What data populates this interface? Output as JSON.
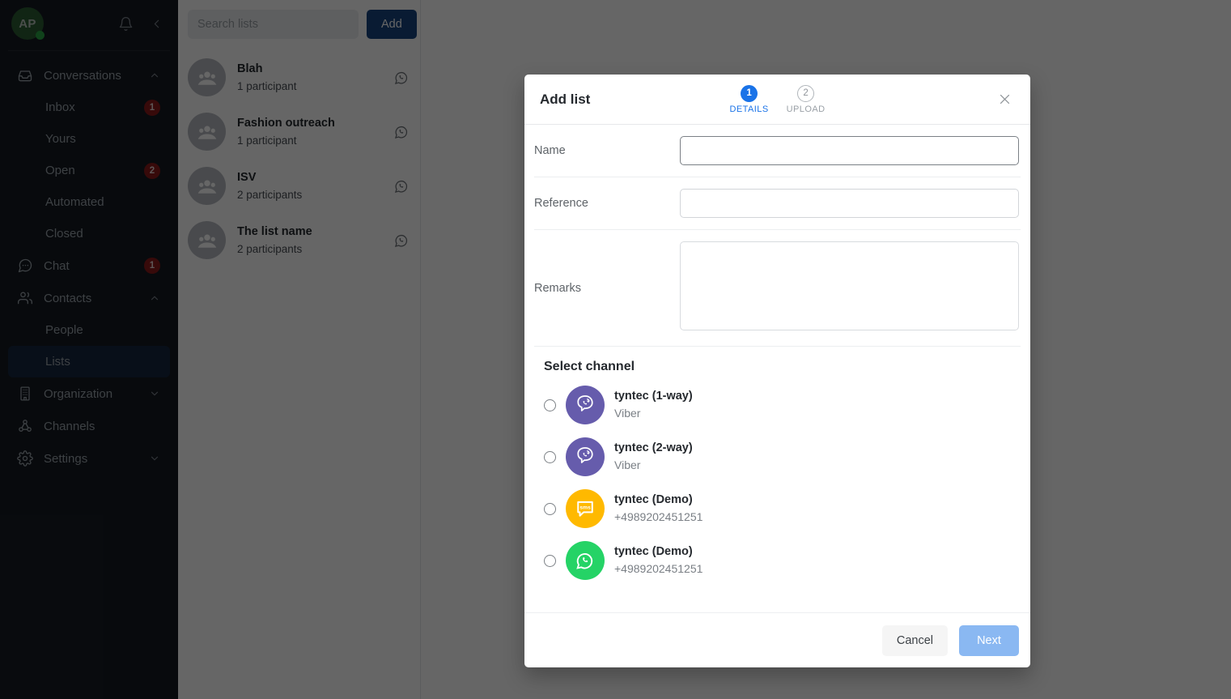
{
  "sidebar": {
    "avatar": {
      "initials": "AP",
      "status_color": "#2aa544",
      "bg_color": "#2b5d34"
    },
    "icons": {
      "notifications": "bell-icon",
      "collapse": "chevron-left-icon"
    },
    "groups": [
      {
        "label": "Conversations",
        "icon": "inbox-tray-icon",
        "expanded": true,
        "items": [
          {
            "label": "Inbox",
            "badge": "1"
          },
          {
            "label": "Yours",
            "badge": ""
          },
          {
            "label": "Open",
            "badge": "2"
          },
          {
            "label": "Automated",
            "badge": ""
          },
          {
            "label": "Closed",
            "badge": ""
          }
        ]
      },
      {
        "label": "Chat",
        "icon": "chat-bubble-icon",
        "badge": "1",
        "expanded": false,
        "items": []
      },
      {
        "label": "Contacts",
        "icon": "people-icon",
        "expanded": true,
        "items": [
          {
            "label": "People",
            "badge": "",
            "active": false
          },
          {
            "label": "Lists",
            "badge": "",
            "active": true
          }
        ]
      },
      {
        "label": "Organization",
        "icon": "building-icon",
        "expanded": false,
        "items": []
      },
      {
        "label": "Channels",
        "icon": "share-nodes-icon",
        "expanded": null,
        "items": []
      },
      {
        "label": "Settings",
        "icon": "gear-icon",
        "expanded": false,
        "items": []
      }
    ],
    "active_item": "Lists",
    "active_bg": "#16263f"
  },
  "list_panel": {
    "search": {
      "placeholder": "Search lists",
      "value": ""
    },
    "add_label": "Add",
    "add_bg": "#17457f",
    "rows": [
      {
        "title": "Blah",
        "subtitle": "1 participant",
        "channel_icon": "whatsapp-icon"
      },
      {
        "title": "Fashion outreach",
        "subtitle": "1 participant",
        "channel_icon": "whatsapp-icon"
      },
      {
        "title": "ISV",
        "subtitle": "2 participants",
        "channel_icon": "whatsapp-icon"
      },
      {
        "title": "The list name",
        "subtitle": "2 participants",
        "channel_icon": "whatsapp-icon"
      }
    ]
  },
  "modal": {
    "title": "Add list",
    "close_icon": "close-icon",
    "steps": [
      {
        "number": "1",
        "label": "DETAILS",
        "state": "active",
        "color": "#1a73e8"
      },
      {
        "number": "2",
        "label": "UPLOAD",
        "state": "inactive",
        "color": "#9aa0a6"
      }
    ],
    "fields": {
      "name": {
        "label": "Name",
        "value": "",
        "placeholder": ""
      },
      "reference": {
        "label": "Reference",
        "value": "",
        "placeholder": ""
      },
      "remarks": {
        "label": "Remarks",
        "value": "",
        "placeholder": ""
      }
    },
    "channel_section": {
      "title": "Select channel",
      "selected": null,
      "channels": [
        {
          "name": "tyntec (1-way)",
          "sub": "Viber",
          "icon": "viber-icon",
          "color": "#665CAC"
        },
        {
          "name": "tyntec (2-way)",
          "sub": "Viber",
          "icon": "viber-icon",
          "color": "#665CAC"
        },
        {
          "name": "tyntec (Demo)",
          "sub": "+4989202451251",
          "icon": "sms-icon",
          "color": "#FFB900"
        },
        {
          "name": "tyntec (Demo)",
          "sub": "+4989202451251",
          "icon": "whatsapp-icon",
          "color": "#25D366"
        }
      ]
    },
    "footer": {
      "cancel_label": "Cancel",
      "next_label": "Next",
      "next_disabled": true,
      "next_bg": "#8ab8f2"
    }
  }
}
